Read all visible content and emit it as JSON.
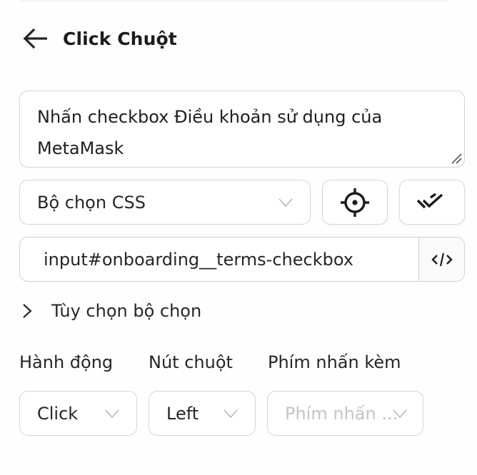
{
  "header": {
    "back_icon": "arrow-left-icon",
    "title": "Click Chuột"
  },
  "description": {
    "value": "Nhấn checkbox Điều khoản sử dụng của MetaMask"
  },
  "selector_type": {
    "selected": "Bộ chọn CSS",
    "icon": "chevron-down-icon"
  },
  "buttons": {
    "pick_element_icon": "crosshair-icon",
    "verify_selector_icon": "double-check-icon",
    "code_icon": "code-icon"
  },
  "selector": {
    "value": "input#onboarding__terms-checkbox"
  },
  "selector_options": {
    "label": "Tùy chọn bộ chọn",
    "icon": "chevron-right-icon",
    "expanded": false
  },
  "fields": {
    "action": {
      "label": "Hành động",
      "selected": "Click"
    },
    "mouse_button": {
      "label": "Nút chuột",
      "selected": "Left"
    },
    "modifier": {
      "label": "Phím nhấn kèm",
      "placeholder": "Phím nhấn ..."
    }
  }
}
